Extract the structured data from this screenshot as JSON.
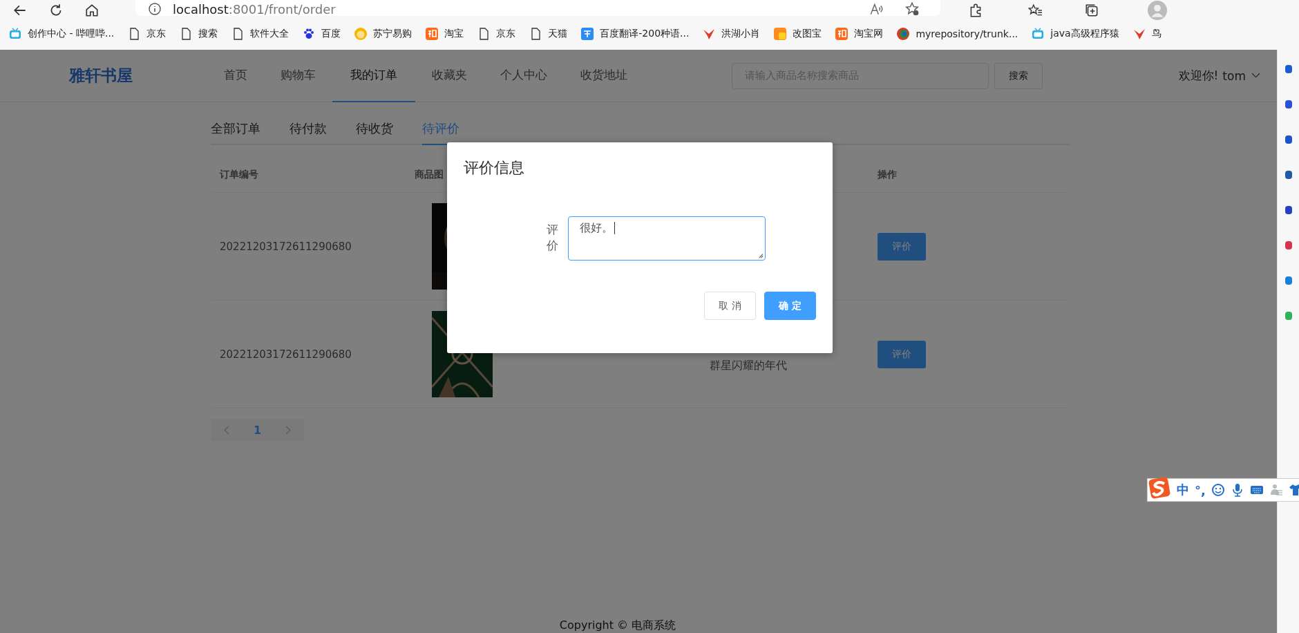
{
  "browser": {
    "address_host": "localhost",
    "address_path": ":8001/front/order",
    "bookmarks": [
      {
        "label": "创作中心 - 哔哩哔...",
        "kind": "tv"
      },
      {
        "label": "京东",
        "kind": "page"
      },
      {
        "label": "搜索",
        "kind": "page"
      },
      {
        "label": "软件大全",
        "kind": "page"
      },
      {
        "label": "百度",
        "kind": "paw"
      },
      {
        "label": "苏宁易购",
        "kind": "sun"
      },
      {
        "label": "淘宝",
        "kind": "tao"
      },
      {
        "label": "京东",
        "kind": "page"
      },
      {
        "label": "天猫",
        "kind": "page"
      },
      {
        "label": "百度翻译-200种语...",
        "kind": "translate"
      },
      {
        "label": "洪湖小肖",
        "kind": "bird"
      },
      {
        "label": "改图宝",
        "kind": "square"
      },
      {
        "label": "淘宝网",
        "kind": "tao"
      },
      {
        "label": "myrepository/trunk...",
        "kind": "globe"
      },
      {
        "label": "java高级程序猿",
        "kind": "tv"
      },
      {
        "label": "鸟",
        "kind": "bird"
      }
    ]
  },
  "header": {
    "logo": "雅轩书屋",
    "nav": [
      {
        "label": "首页",
        "selected": false
      },
      {
        "label": "购物车",
        "selected": false
      },
      {
        "label": "我的订单",
        "selected": true
      },
      {
        "label": "收藏夹",
        "selected": false
      },
      {
        "label": "个人中心",
        "selected": false
      },
      {
        "label": "收货地址",
        "selected": false
      }
    ],
    "search": {
      "placeholder": "请输入商品名称搜索商品",
      "button": "搜索"
    },
    "welcome": "欢迎你!",
    "user": "tom"
  },
  "order_tabs": [
    {
      "label": "全部订单",
      "selected": false
    },
    {
      "label": "待付款",
      "selected": false
    },
    {
      "label": "待收货",
      "selected": false
    },
    {
      "label": "待评价",
      "selected": true
    }
  ],
  "table": {
    "columns": [
      "订单编号",
      "商品图",
      "操作"
    ],
    "rows": [
      {
        "order_no": "20221203172611290680",
        "kind": "picture",
        "action": "评价"
      },
      {
        "order_no": "20221203172611290680",
        "kind": "picture",
        "name": "群星闪耀的年代",
        "action": "评价"
      }
    ]
  },
  "pagination": {
    "pages": [
      {
        "label": "1",
        "selected": true
      }
    ]
  },
  "footer": "Copyright © 电商系统",
  "dialog": {
    "title": "评价信息",
    "label": "评价",
    "value": "很好。",
    "buttons": [
      {
        "label": "取 消",
        "kind": "default"
      },
      {
        "label": "确 定",
        "kind": "primary"
      }
    ]
  },
  "ime": {
    "mode": "中",
    "punct": "°,"
  }
}
